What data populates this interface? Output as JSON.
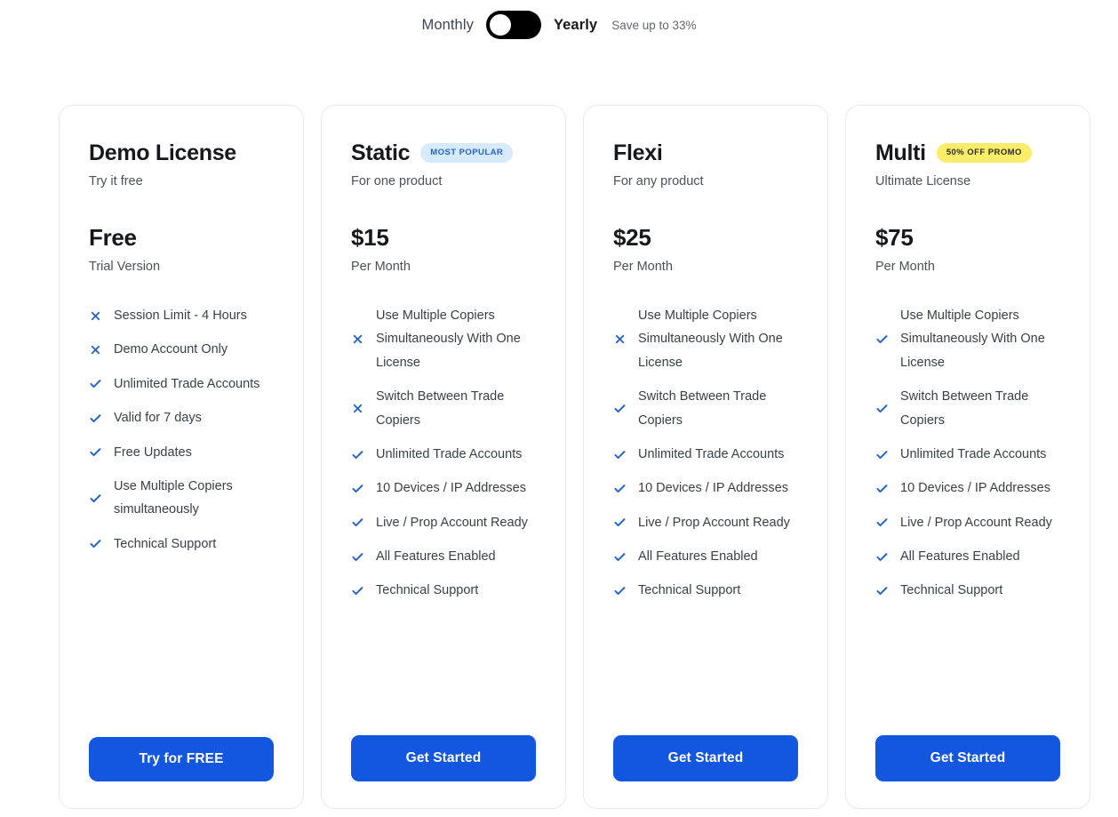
{
  "billing": {
    "monthly_label": "Monthly",
    "yearly_label": "Yearly",
    "save_note": "Save up to 33%",
    "selected": "Monthly",
    "toggle_icon": "toggle-switch-icon",
    "accent_color": "#000000"
  },
  "colors": {
    "cta_blue": "#1357e0",
    "icon_blue": "#2563c9",
    "badge_popular_bg": "#d6eafc",
    "badge_popular_text": "#2563c9",
    "badge_promo_bg": "#fbed6a",
    "badge_promo_text": "#2a2a22",
    "card_border": "#e8e9eb"
  },
  "icons": {
    "check": "check-icon",
    "cross": "cross-icon"
  },
  "plans": [
    {
      "name": "Demo License",
      "badge": null,
      "subtitle": "Try it free",
      "price": "Free",
      "period": "Trial Version",
      "cta": "Try for FREE",
      "features": [
        {
          "included": false,
          "text": "Session Limit - 4 Hours"
        },
        {
          "included": false,
          "text": "Demo Account Only"
        },
        {
          "included": true,
          "text": "Unlimited Trade Accounts"
        },
        {
          "included": true,
          "text": "Valid for 7 days"
        },
        {
          "included": true,
          "text": "Free Updates"
        },
        {
          "included": true,
          "text": "Use Multiple Copiers simultaneously"
        },
        {
          "included": true,
          "text": "Technical Support"
        }
      ]
    },
    {
      "name": "Static",
      "badge": {
        "text": "MOST POPULAR",
        "style": "popular"
      },
      "subtitle": "For one product",
      "price": "$15",
      "period": "Per Month",
      "cta": "Get Started",
      "features": [
        {
          "included": false,
          "text": "Use Multiple Copiers Simultaneously With One License"
        },
        {
          "included": false,
          "text": "Switch Between Trade Copiers"
        },
        {
          "included": true,
          "text": "Unlimited Trade Accounts"
        },
        {
          "included": true,
          "text": "10 Devices / IP Addresses"
        },
        {
          "included": true,
          "text": "Live / Prop Account Ready"
        },
        {
          "included": true,
          "text": "All Features Enabled"
        },
        {
          "included": true,
          "text": "Technical Support"
        }
      ]
    },
    {
      "name": "Flexi",
      "badge": null,
      "subtitle": "For any product",
      "price": "$25",
      "period": "Per Month",
      "cta": "Get Started",
      "features": [
        {
          "included": false,
          "text": "Use Multiple Copiers Simultaneously With One License"
        },
        {
          "included": true,
          "text": "Switch Between Trade Copiers"
        },
        {
          "included": true,
          "text": "Unlimited Trade Accounts"
        },
        {
          "included": true,
          "text": "10 Devices / IP Addresses"
        },
        {
          "included": true,
          "text": "Live / Prop Account Ready"
        },
        {
          "included": true,
          "text": "All Features Enabled"
        },
        {
          "included": true,
          "text": "Technical Support"
        }
      ]
    },
    {
      "name": "Multi",
      "badge": {
        "text": "50% OFF PROMO",
        "style": "promo"
      },
      "subtitle": "Ultimate License",
      "price": "$75",
      "period": "Per Month",
      "cta": "Get Started",
      "features": [
        {
          "included": true,
          "text": "Use Multiple Copiers Simultaneously With One License"
        },
        {
          "included": true,
          "text": "Switch Between Trade Copiers"
        },
        {
          "included": true,
          "text": "Unlimited Trade Accounts"
        },
        {
          "included": true,
          "text": "10 Devices / IP Addresses"
        },
        {
          "included": true,
          "text": "Live / Prop Account Ready"
        },
        {
          "included": true,
          "text": "All Features Enabled"
        },
        {
          "included": true,
          "text": "Technical Support"
        }
      ]
    }
  ]
}
